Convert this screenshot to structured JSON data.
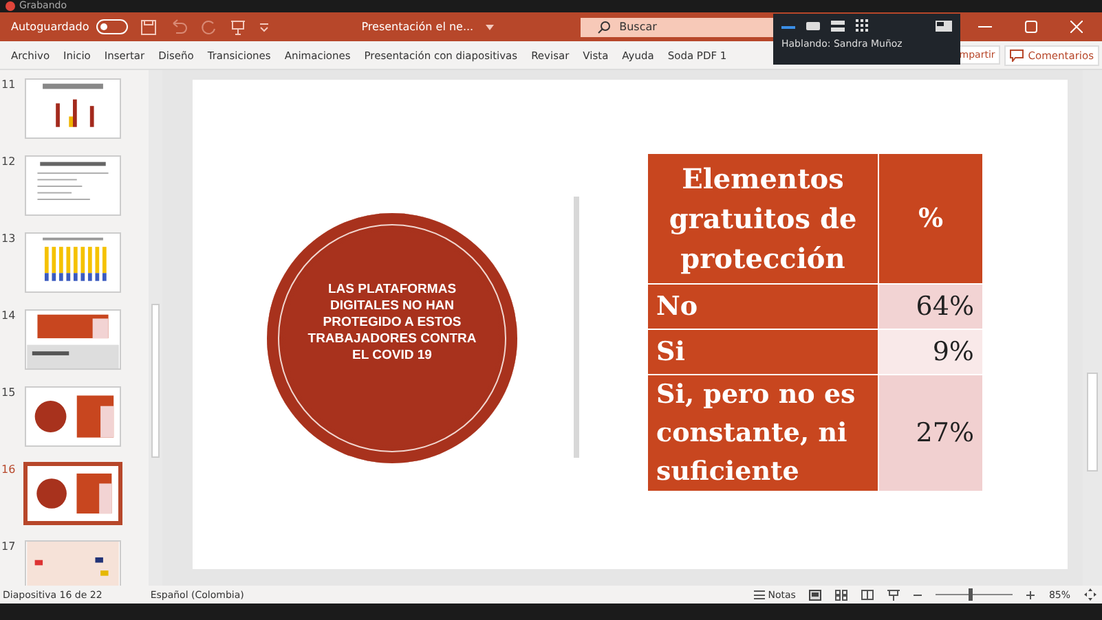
{
  "recording": {
    "label": "Grabando"
  },
  "title_bar": {
    "autosave_label": "Autoguardado",
    "autosave_on": false,
    "title": "Presentación el ne...",
    "search_placeholder": "Buscar"
  },
  "ribbon_tabs": [
    {
      "label": "Archivo",
      "selected": false
    },
    {
      "label": "Inicio",
      "selected": false
    },
    {
      "label": "Insertar",
      "selected": false
    },
    {
      "label": "Diseño",
      "selected": false
    },
    {
      "label": "Transiciones",
      "selected": false
    },
    {
      "label": "Animaciones",
      "selected": false
    },
    {
      "label": "Presentación con diapositivas",
      "selected": false
    },
    {
      "label": "Revisar",
      "selected": false
    },
    {
      "label": "Vista",
      "selected": false
    },
    {
      "label": "Ayuda",
      "selected": false
    },
    {
      "label": "Soda PDF 1",
      "selected": false
    }
  ],
  "share_button": "mpartir",
  "comments_button": "Comentarios",
  "call_overlay": {
    "speaking": "Hablando: Sandra Muñoz"
  },
  "thumbnails": [
    {
      "number": "11",
      "kind": "chart",
      "selected": false
    },
    {
      "number": "12",
      "kind": "text",
      "selected": false
    },
    {
      "number": "13",
      "kind": "bars",
      "selected": false
    },
    {
      "number": "14",
      "kind": "table",
      "selected": false
    },
    {
      "number": "15",
      "kind": "circle",
      "selected": false
    },
    {
      "number": "16",
      "kind": "circle",
      "selected": true
    },
    {
      "number": "17",
      "kind": "map",
      "selected": false
    }
  ],
  "slide": {
    "circle_text": "LAS PLATAFORMAS DIGITALES NO HAN PROTEGIDO A ESTOS TRABAJADORES CONTRA EL COVID 19",
    "table": {
      "columns": [
        "Elementos gratuitos de protección",
        "%"
      ],
      "rows": [
        {
          "label": "No",
          "value": "64%",
          "color": "#f2d3d3"
        },
        {
          "label": "Si",
          "value": "9%",
          "color": "#f9e9e9"
        },
        {
          "label": "Si, pero no es constante, ni suficiente",
          "value": "27%",
          "color": "#f1d0d0"
        }
      ]
    }
  },
  "status_bar": {
    "slide_count": "Diapositiva 16 de 22",
    "language": "Español (Colombia)",
    "notes": "Notas",
    "zoom": {
      "level": 0.42
    },
    "zoom_value": "85%"
  }
}
